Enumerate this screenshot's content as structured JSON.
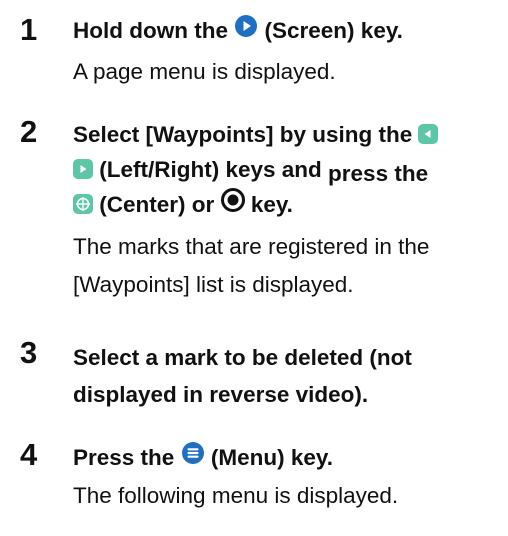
{
  "steps": [
    {
      "number": "1",
      "instruction_prefix": "Hold down the",
      "instruction_suffix": "(Screen) key.",
      "result": "A page menu is displayed."
    },
    {
      "number": "2",
      "instruction_line1": "Select [Waypoints] by using the",
      "instruction_line2a": "(Left/Right) keys and ",
      "instruction_line2b": "press the",
      "instruction_line3a": "(Center) or",
      "instruction_line3b": "key.",
      "result_line1": "The marks that are registered in the",
      "result_line2": "[Waypoints] list is displayed."
    },
    {
      "number": "3",
      "instruction_line1": "Select a mark to be deleted (not",
      "instruction_line2": "displayed in reverse video)."
    },
    {
      "number": "4",
      "instruction_prefix": "Press the",
      "instruction_suffix": "(Menu) key.",
      "result": "The following menu is displayed."
    }
  ],
  "icons": {
    "screen_key": "screen-key-icon",
    "left_key": "left-key-icon",
    "right_key": "right-key-icon",
    "center_key": "center-key-icon",
    "enter_key": "enter-key-icon",
    "menu_key": "menu-key-icon"
  },
  "colors": {
    "screen_key": "#1f6fc2",
    "arrow_keys": "#5cc6a6",
    "menu_key": "#1f6fc2",
    "text": "#111111"
  }
}
